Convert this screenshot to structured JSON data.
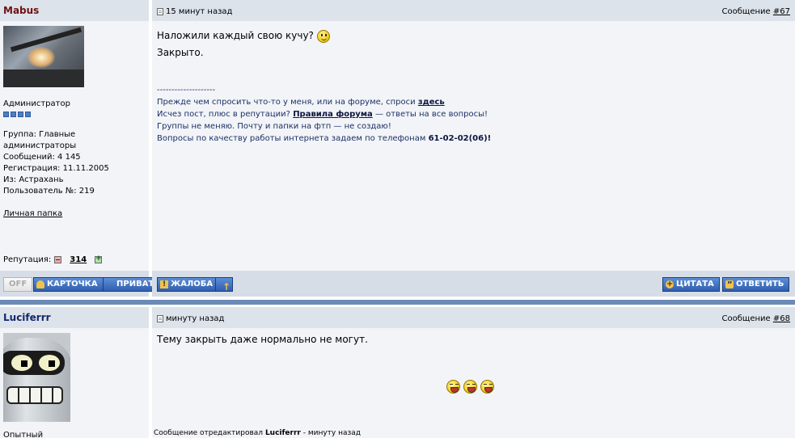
{
  "posts": [
    {
      "author": "Mabus",
      "time": "15 минут назад",
      "num_prefix": "Сообщение",
      "num_link": "#67",
      "user_title": "Администратор",
      "group": "Группа: Главные администраторы",
      "group_line1": "Группа: Главные",
      "group_line2": "администраторы",
      "messages_count": "Сообщений: 4 145",
      "registered": "Регистрация: 11.11.2005",
      "location": "Из: Астрахань",
      "user_no": "Пользователь №: 219",
      "folder_link": "Личная папка",
      "reputation_label": "Репутация:",
      "reputation_value": "314",
      "body_line1": "Наложили каждый свою кучу?",
      "body_line2": "Закрыто.",
      "signature": {
        "dashes": "--------------------",
        "line1_text": "Прежде чем спросить что-то у меня, или на форуме, спроси",
        "line1_link": "здесь",
        "line2_pre": "Исчез пост, плюс в репутации?",
        "line2_link": "Правила форума",
        "line2_post": "— ответы на все вопросы!",
        "line3": "Группы не меняю. Почту и папки на фтп — не создаю!",
        "line4_text": "Вопросы по качеству работы интернета задаем по телефонам",
        "line4_bold": "61-02-02(06)!"
      },
      "buttons": {
        "off": "OFF",
        "card": "КАРТОЧКА",
        "private": "ПРИВАТ",
        "complaint": "ЖАЛОБА",
        "quote": "ЦИТАТА",
        "reply": "ОТВЕТИТЬ"
      }
    },
    {
      "author": "Luciferrr",
      "time": "минуту назад",
      "num_prefix": "Сообщение",
      "num_link": "#68",
      "user_title": "Опытный",
      "body_line1": "Тему закрыть даже нормально не могут.",
      "edited_pre": "Сообщение отредактировал",
      "edited_author": "Luciferrr",
      "edited_post": "- минуту назад"
    }
  ],
  "colors": {
    "header_bg": "#dde3eb",
    "post_bg": "#f2f4f7",
    "button_blue": "#2f5fae",
    "separator": "#6b8ab6",
    "admin_name": "#6e1212",
    "user_name": "#14286e"
  }
}
